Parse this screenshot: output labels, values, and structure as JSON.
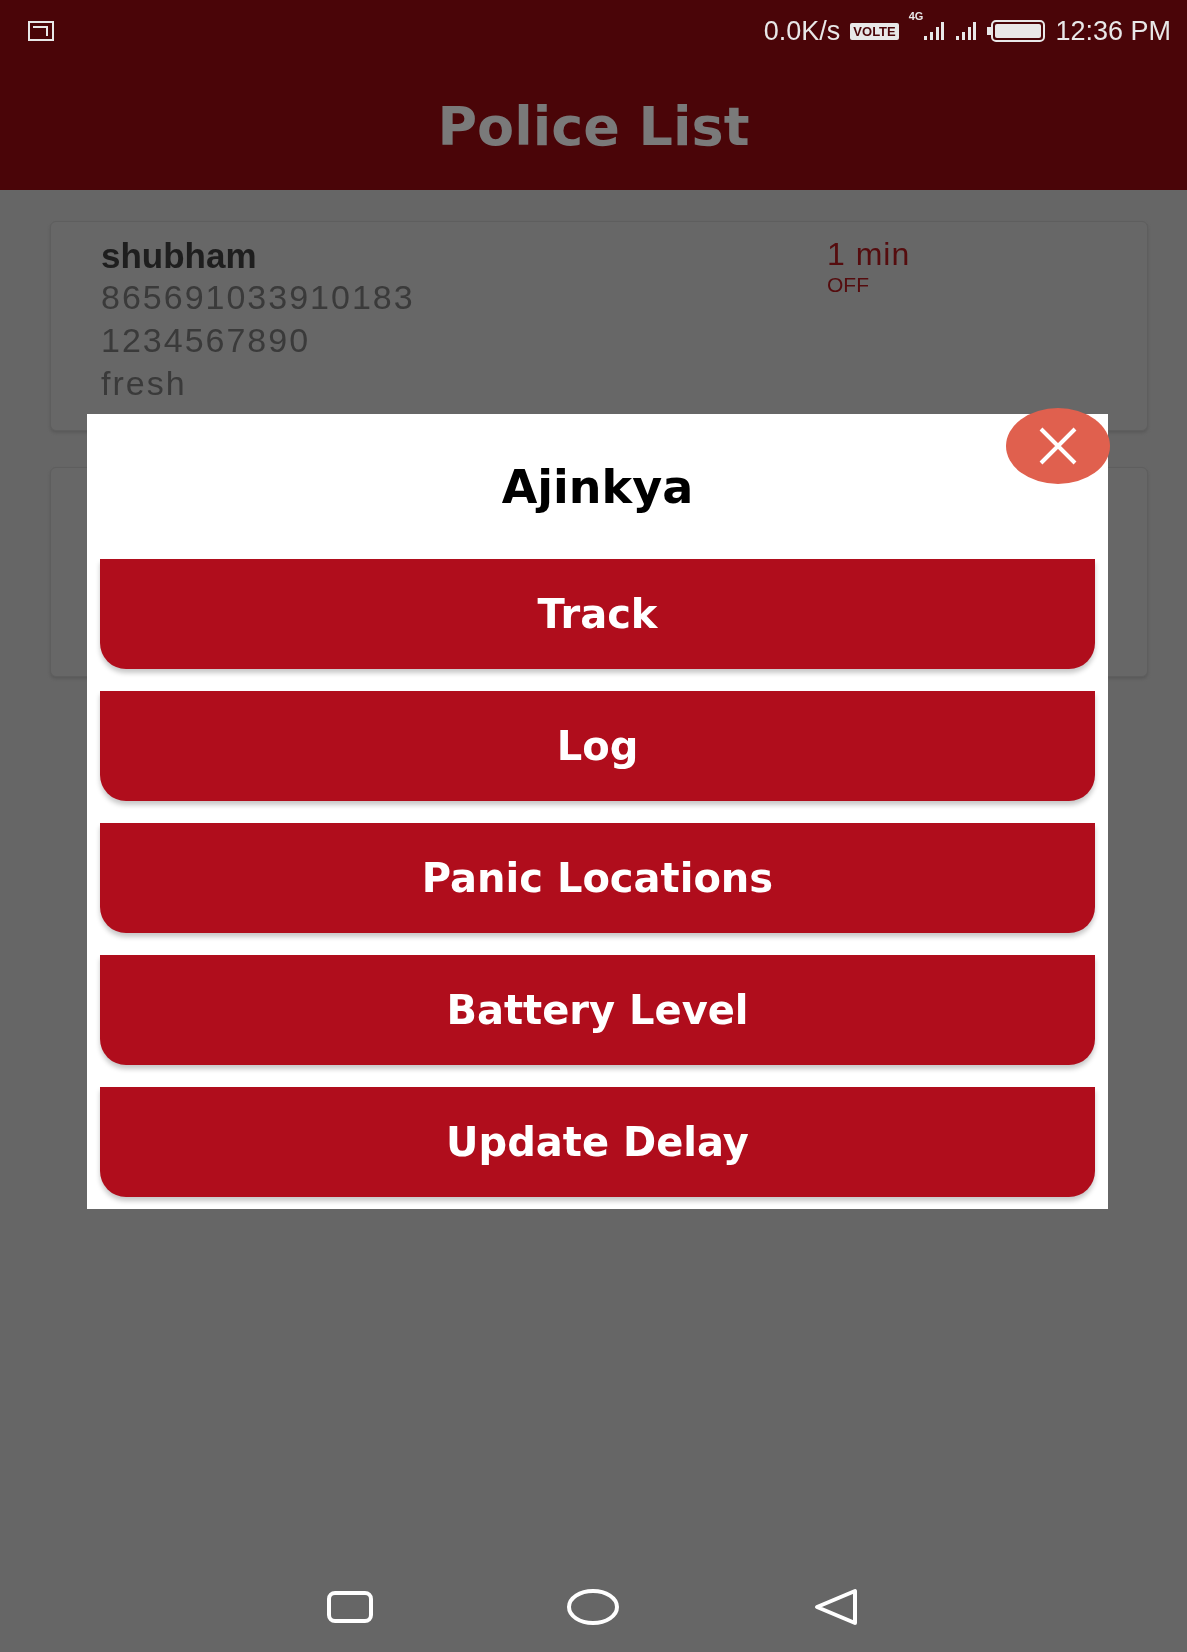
{
  "status_bar": {
    "speed": "0.0K/s",
    "volte": "VOLTE",
    "network": "4G",
    "time": "12:36 PM"
  },
  "header": {
    "title": "Police List"
  },
  "cards": [
    {
      "name": "shubham",
      "imei": "865691033910183",
      "phone": "1234567890",
      "status": "fresh",
      "delay": "1 min",
      "state": "OFF"
    }
  ],
  "dialog": {
    "title": "Ajinkya",
    "buttons": [
      "Track",
      "Log",
      "Panic Locations",
      "Battery Level",
      "Update Delay"
    ]
  }
}
